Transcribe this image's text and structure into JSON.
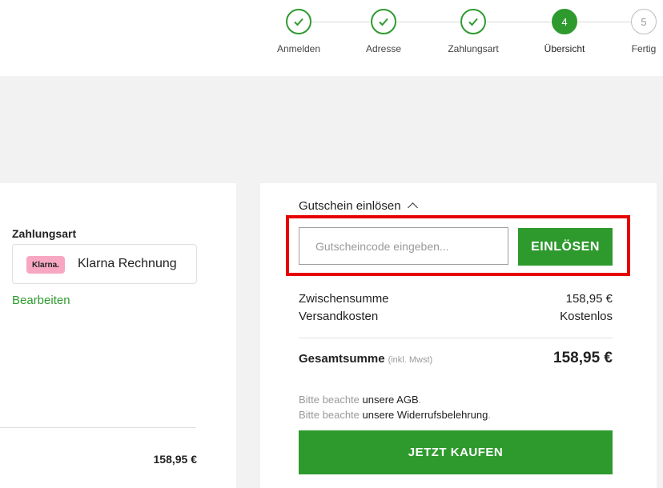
{
  "steps": [
    {
      "label": "Anmelden",
      "state": "done",
      "icon": "check-icon"
    },
    {
      "label": "Adresse",
      "state": "done",
      "icon": "check-icon"
    },
    {
      "label": "Zahlungsart",
      "state": "done",
      "icon": "check-icon"
    },
    {
      "label": "Übersicht",
      "state": "current",
      "number": "4"
    },
    {
      "label": "Fertig",
      "state": "todo",
      "number": "5"
    }
  ],
  "payment": {
    "title": "Zahlungsart",
    "badge": "Klarna.",
    "method": "Klarna Rechnung",
    "edit_label": "Bearbeiten"
  },
  "left_total": "158,95 €",
  "coupon": {
    "toggle_label": "Gutschein einlösen",
    "placeholder": "Gutscheincode eingeben...",
    "value": "",
    "button_label": "EINLÖSEN"
  },
  "summary": {
    "subtotal_label": "Zwischensumme",
    "subtotal_value": "158,95 €",
    "shipping_label": "Versandkosten",
    "shipping_value": "Kostenlos",
    "total_label": "Gesamtsumme",
    "total_note": "(inkl. Mwst)",
    "total_value": "158,95 €"
  },
  "notes": {
    "agb_prefix": "Bitte beachte",
    "agb_link": "unsere AGB",
    "agb_suffix": ".",
    "withdrawal_prefix": "Bitte beachte",
    "withdrawal_link": "unsere Widerrufsbelehrung",
    "withdrawal_suffix": "."
  },
  "buy_button_label": "JETZT KAUFEN",
  "colors": {
    "accent": "#2e9a2e",
    "highlight": "#e60000",
    "klarna_pink": "#f7a7c2"
  }
}
